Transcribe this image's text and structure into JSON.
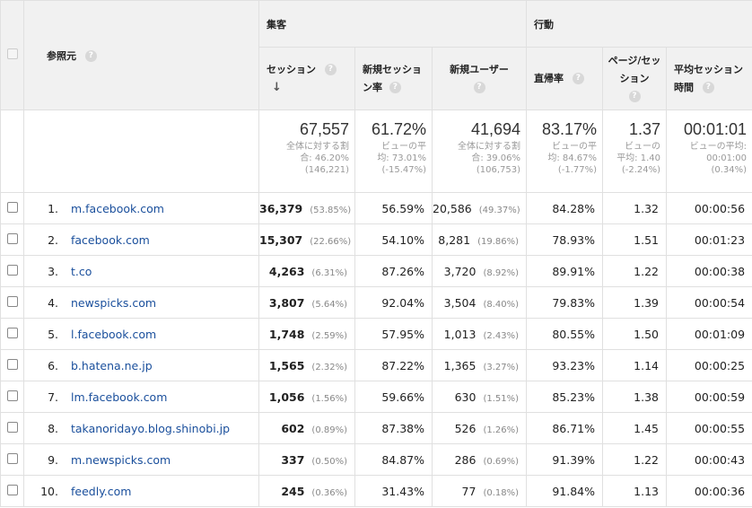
{
  "header": {
    "referrer_label": "参照元",
    "group_acquisition": "集客",
    "group_behavior": "行動",
    "col_sessions": "セッション",
    "col_new_session_rate": "新規セッション率",
    "col_new_users": "新規ユーザー",
    "col_bounce_rate": "直帰率",
    "col_pages_per_session": "ページ/セッション",
    "col_avg_duration": "平均セッション時間",
    "help_glyph": "?",
    "sort_glyph": "↓"
  },
  "summary": {
    "sessions": {
      "value": "67,557",
      "lines": [
        "全体に対する割",
        "合: 46.20%",
        "(146,221)"
      ]
    },
    "new_session_rate": {
      "value": "61.72%",
      "lines": [
        "ビューの平",
        "均: 73.01%",
        "(-15.47%)"
      ]
    },
    "new_users": {
      "value": "41,694",
      "lines": [
        "全体に対する割",
        "合: 39.06%",
        "(106,753)"
      ]
    },
    "bounce_rate": {
      "value": "83.17%",
      "lines": [
        "ビューの平",
        "均: 84.67%",
        "(-1.77%)"
      ]
    },
    "pages_per_session": {
      "value": "1.37",
      "lines": [
        "ビューの",
        "平均: 1.40",
        "(-2.24%)"
      ]
    },
    "avg_duration": {
      "value": "00:01:01",
      "lines": [
        "ビューの平均:",
        "00:01:00",
        "(0.34%)"
      ]
    }
  },
  "rows": [
    {
      "idx": "1.",
      "source": "m.facebook.com",
      "sessions": "36,379",
      "sessions_pct": "(53.85%)",
      "new_session_rate": "56.59%",
      "new_users": "20,586",
      "new_users_pct": "(49.37%)",
      "bounce_rate": "84.28%",
      "pages_per_session": "1.32",
      "avg_duration": "00:00:56"
    },
    {
      "idx": "2.",
      "source": "facebook.com",
      "sessions": "15,307",
      "sessions_pct": "(22.66%)",
      "new_session_rate": "54.10%",
      "new_users": "8,281",
      "new_users_pct": "(19.86%)",
      "bounce_rate": "78.93%",
      "pages_per_session": "1.51",
      "avg_duration": "00:01:23"
    },
    {
      "idx": "3.",
      "source": "t.co",
      "sessions": "4,263",
      "sessions_pct": "(6.31%)",
      "new_session_rate": "87.26%",
      "new_users": "3,720",
      "new_users_pct": "(8.92%)",
      "bounce_rate": "89.91%",
      "pages_per_session": "1.22",
      "avg_duration": "00:00:38"
    },
    {
      "idx": "4.",
      "source": "newspicks.com",
      "sessions": "3,807",
      "sessions_pct": "(5.64%)",
      "new_session_rate": "92.04%",
      "new_users": "3,504",
      "new_users_pct": "(8.40%)",
      "bounce_rate": "79.83%",
      "pages_per_session": "1.39",
      "avg_duration": "00:00:54"
    },
    {
      "idx": "5.",
      "source": "l.facebook.com",
      "sessions": "1,748",
      "sessions_pct": "(2.59%)",
      "new_session_rate": "57.95%",
      "new_users": "1,013",
      "new_users_pct": "(2.43%)",
      "bounce_rate": "80.55%",
      "pages_per_session": "1.50",
      "avg_duration": "00:01:09"
    },
    {
      "idx": "6.",
      "source": "b.hatena.ne.jp",
      "sessions": "1,565",
      "sessions_pct": "(2.32%)",
      "new_session_rate": "87.22%",
      "new_users": "1,365",
      "new_users_pct": "(3.27%)",
      "bounce_rate": "93.23%",
      "pages_per_session": "1.14",
      "avg_duration": "00:00:25"
    },
    {
      "idx": "7.",
      "source": "lm.facebook.com",
      "sessions": "1,056",
      "sessions_pct": "(1.56%)",
      "new_session_rate": "59.66%",
      "new_users": "630",
      "new_users_pct": "(1.51%)",
      "bounce_rate": "85.23%",
      "pages_per_session": "1.38",
      "avg_duration": "00:00:59"
    },
    {
      "idx": "8.",
      "source": "takanoridayo.blog.shinobi.jp",
      "sessions": "602",
      "sessions_pct": "(0.89%)",
      "new_session_rate": "87.38%",
      "new_users": "526",
      "new_users_pct": "(1.26%)",
      "bounce_rate": "86.71%",
      "pages_per_session": "1.45",
      "avg_duration": "00:00:55"
    },
    {
      "idx": "9.",
      "source": "m.newspicks.com",
      "sessions": "337",
      "sessions_pct": "(0.50%)",
      "new_session_rate": "84.87%",
      "new_users": "286",
      "new_users_pct": "(0.69%)",
      "bounce_rate": "91.39%",
      "pages_per_session": "1.22",
      "avg_duration": "00:00:43"
    },
    {
      "idx": "10.",
      "source": "feedly.com",
      "sessions": "245",
      "sessions_pct": "(0.36%)",
      "new_session_rate": "31.43%",
      "new_users": "77",
      "new_users_pct": "(0.18%)",
      "bounce_rate": "91.84%",
      "pages_per_session": "1.13",
      "avg_duration": "00:00:36"
    }
  ]
}
